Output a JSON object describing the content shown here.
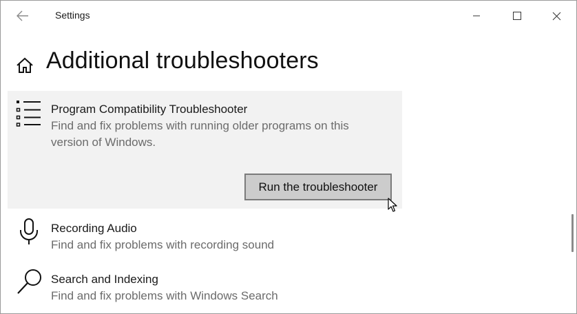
{
  "window": {
    "title": "Settings"
  },
  "page": {
    "title": "Additional troubleshooters"
  },
  "items": [
    {
      "title": "Program Compatibility Troubleshooter",
      "description_line1": "Find and fix problems with running older programs on this",
      "description_line2": "version of Windows.",
      "icon": "list-icon",
      "expanded": true,
      "button_label": "Run the troubleshooter"
    },
    {
      "title": "Recording Audio",
      "description": "Find and fix problems with recording sound",
      "icon": "microphone-icon"
    },
    {
      "title": "Search and Indexing",
      "description": "Find and fix problems with Windows Search",
      "icon": "search-icon"
    }
  ],
  "colors": {
    "card_background": "#f2f2f2",
    "button_background": "#cccccc",
    "button_border": "#7a7a7a",
    "description_text": "#6b6b6b"
  }
}
